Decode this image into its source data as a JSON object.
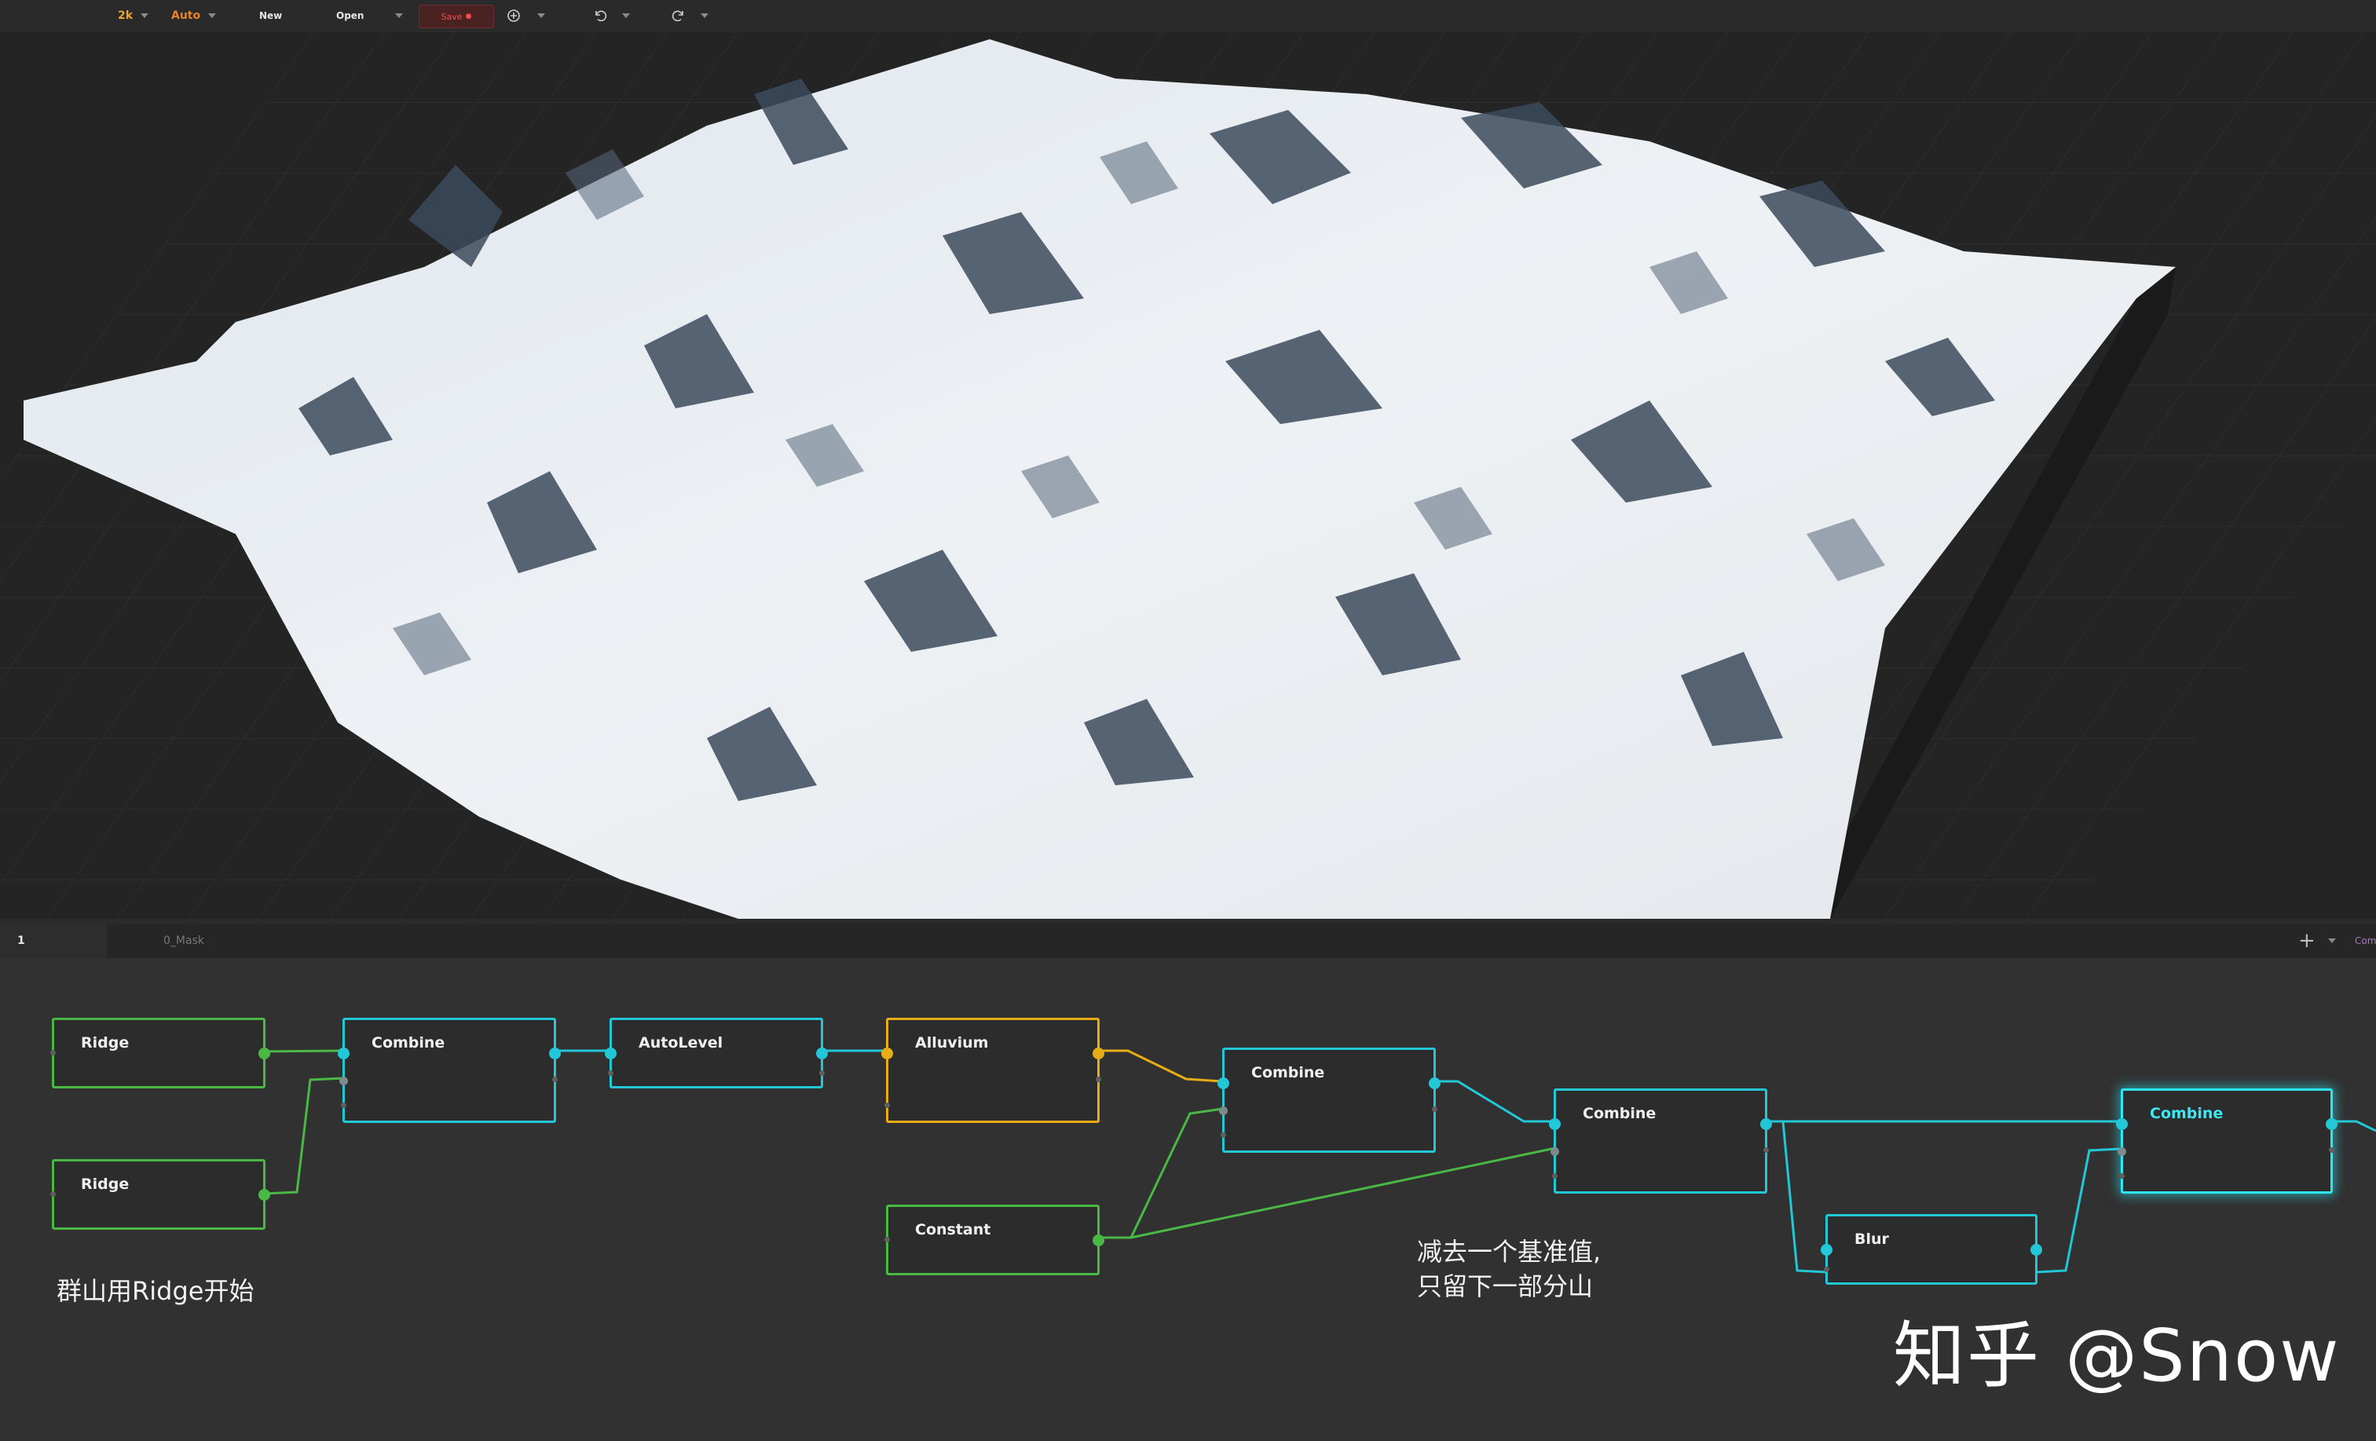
{
  "toolbar": {
    "resolution": "2k",
    "mode": "Auto",
    "new_label": "New",
    "open_label": "Open",
    "save_label": "Save",
    "colors": {
      "resolution": "#e8a826",
      "mode": "#e8832a",
      "save": "#ff4a4a"
    }
  },
  "icons": [
    "plus-circle-icon",
    "undo-icon",
    "redo-icon",
    "chevron-down-icon",
    "plus-icon"
  ],
  "tabs": {
    "active": "1",
    "mask": "0_Mask",
    "overflow": "Com"
  },
  "nodes": [
    {
      "id": "ridge-1",
      "label": "Ridge",
      "kind": "green"
    },
    {
      "id": "ridge-2",
      "label": "Ridge",
      "kind": "green"
    },
    {
      "id": "combine-1",
      "label": "Combine",
      "kind": "cyan"
    },
    {
      "id": "autolevel",
      "label": "AutoLevel",
      "kind": "cyan"
    },
    {
      "id": "alluvium",
      "label": "Alluvium",
      "kind": "gold"
    },
    {
      "id": "constant",
      "label": "Constant",
      "kind": "green"
    },
    {
      "id": "combine-2",
      "label": "Combine",
      "kind": "cyan"
    },
    {
      "id": "combine-3",
      "label": "Combine",
      "kind": "cyan"
    },
    {
      "id": "blur",
      "label": "Blur",
      "kind": "cyan"
    },
    {
      "id": "combine-4",
      "label": "Combine",
      "kind": "cyan-selected"
    }
  ],
  "annotations": {
    "ridge_note": "群山用Ridge开始",
    "subtract_line1": "减去一个基准值,",
    "subtract_line2": "只留下一部分山"
  },
  "watermark": "知乎 @Snow"
}
